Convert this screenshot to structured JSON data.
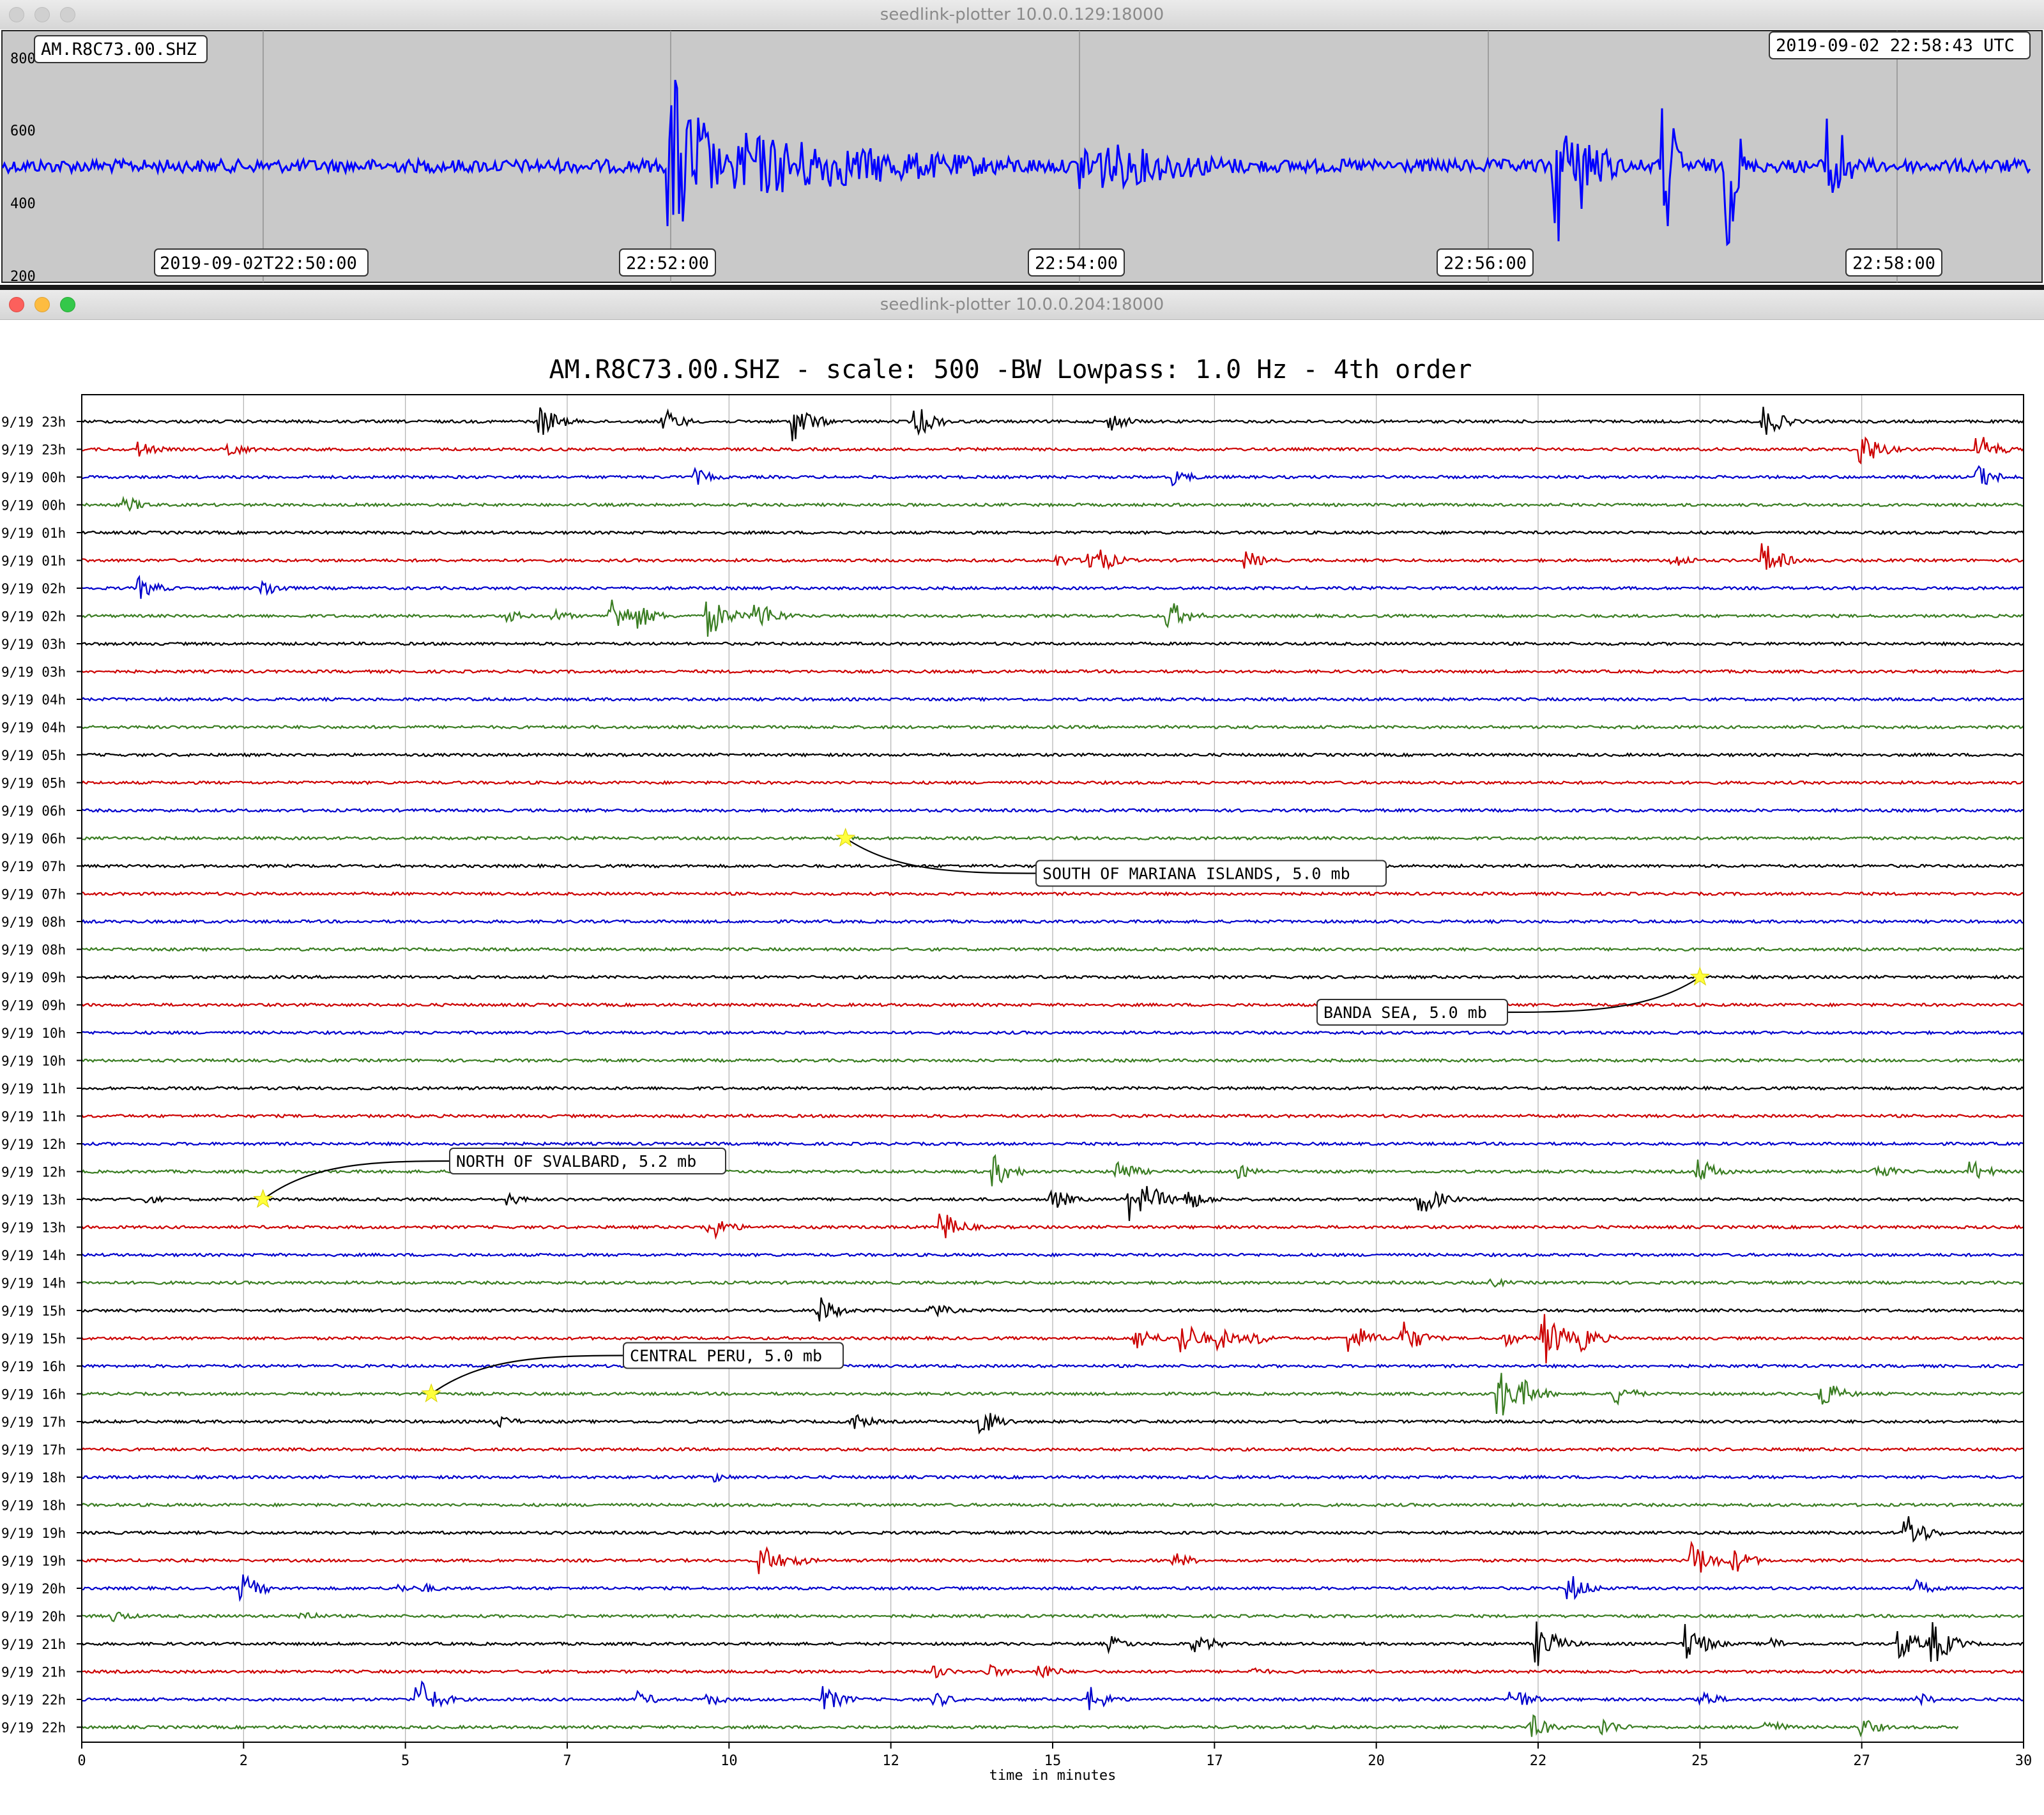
{
  "top_window": {
    "title": "seedlink-plotter 10.0.0.129:18000",
    "station_label": "AM.R8C73.00.SHZ",
    "time_label": "2019-09-02 22:58:43 UTC",
    "y_ticks": [
      "800",
      "600",
      "400",
      "200"
    ],
    "time_ticks": [
      "2019-09-02T22:50:00",
      "22:52:00",
      "22:54:00",
      "22:56:00",
      "22:58:00"
    ],
    "trace_color": "#0000ff",
    "panel_color": "#c9c9c9"
  },
  "bottom_window": {
    "title": "seedlink-plotter 10.0.0.204:18000"
  },
  "chart_data": {
    "type": "line",
    "title": "AM.R8C73.00.SHZ - scale: 500 -BW Lowpass: 1.0 Hz - 4th order",
    "xlabel": "time in minutes",
    "x_ticks": [
      "0",
      "2",
      "5",
      "7",
      "10",
      "12",
      "15",
      "17",
      "20",
      "22",
      "25",
      "27",
      "30"
    ],
    "xlim": [
      0,
      30
    ],
    "grid": true,
    "row_colors": [
      "#000000",
      "#cc0000",
      "#0000cc",
      "#3a7d22"
    ],
    "rows": [
      "9/19 23h",
      "9/19 23h",
      "9/19 00h",
      "9/19 00h",
      "9/19 01h",
      "9/19 01h",
      "9/19 02h",
      "9/19 02h",
      "9/19 03h",
      "9/19 03h",
      "9/19 04h",
      "9/19 04h",
      "9/19 05h",
      "9/19 05h",
      "9/19 06h",
      "9/19 06h",
      "9/19 07h",
      "9/19 07h",
      "9/19 08h",
      "9/19 08h",
      "9/19 09h",
      "9/19 09h",
      "9/19 10h",
      "9/19 10h",
      "9/19 11h",
      "9/19 11h",
      "9/19 12h",
      "9/19 12h",
      "9/19 13h",
      "9/19 13h",
      "9/19 14h",
      "9/19 14h",
      "9/19 15h",
      "9/19 15h",
      "9/19 16h",
      "9/19 16h",
      "9/19 17h",
      "9/19 17h",
      "9/19 18h",
      "9/19 18h",
      "9/19 19h",
      "9/19 19h",
      "9/19 20h",
      "9/19 20h",
      "9/19 21h",
      "9/19 21h",
      "9/19 22h",
      "9/19 22h"
    ],
    "bursts": [
      {
        "row": 0,
        "t": [
          7.1,
          9.0,
          11.0,
          12.9,
          15.9,
          26.0
        ],
        "a": [
          1.0,
          0.8,
          1.3,
          1.0,
          0.6,
          1.0
        ]
      },
      {
        "row": 1,
        "t": [
          0.9,
          2.3,
          27.5,
          29.3
        ],
        "a": [
          0.5,
          0.5,
          1.2,
          1.0
        ]
      },
      {
        "row": 2,
        "t": [
          9.5,
          16.9,
          29.3
        ],
        "a": [
          0.5,
          0.5,
          0.8
        ]
      },
      {
        "row": 3,
        "t": [
          0.7
        ],
        "a": [
          0.5
        ]
      },
      {
        "row": 5,
        "t": [
          15.1,
          15.6,
          18.0,
          24.6,
          26.0
        ],
        "a": [
          0.4,
          1.2,
          0.6,
          0.5,
          1.1
        ]
      },
      {
        "row": 6,
        "t": [
          0.9,
          2.8
        ],
        "a": [
          0.7,
          0.6
        ]
      },
      {
        "row": 7,
        "t": [
          6.6,
          7.3,
          8.2,
          8.6,
          9.7,
          10.4,
          16.8
        ],
        "a": [
          0.4,
          0.4,
          1.2,
          0.8,
          1.3,
          1.2,
          1.0
        ]
      },
      {
        "row": 27,
        "t": [
          14.1,
          16.0,
          17.9,
          25.0,
          27.7,
          29.2
        ],
        "a": [
          1.0,
          0.8,
          0.4,
          0.8,
          0.6,
          0.7
        ]
      },
      {
        "row": 28,
        "t": [
          1.0,
          6.6,
          15.0,
          16.2,
          16.5,
          17.1,
          20.7
        ],
        "a": [
          0.3,
          0.4,
          0.7,
          1.3,
          0.9,
          0.7,
          1.1
        ]
      },
      {
        "row": 29,
        "t": [
          9.7,
          13.3
        ],
        "a": [
          0.9,
          1.0
        ]
      },
      {
        "row": 31,
        "t": [
          21.8
        ],
        "a": [
          0.3
        ]
      },
      {
        "row": 32,
        "t": [
          11.4,
          13.1
        ],
        "a": [
          0.9,
          0.6
        ]
      },
      {
        "row": 33,
        "t": [
          16.3,
          17.0,
          17.6,
          18.1,
          19.6,
          20.4,
          22.0,
          22.6,
          23.2
        ],
        "a": [
          0.8,
          1.2,
          0.7,
          0.5,
          1.1,
          1.2,
          0.5,
          1.8,
          0.8
        ]
      },
      {
        "row": 35,
        "t": [
          21.9,
          22.3,
          23.7,
          26.9
        ],
        "a": [
          1.8,
          0.8,
          0.7,
          0.9
        ]
      },
      {
        "row": 36,
        "t": [
          6.4,
          11.9,
          13.9
        ],
        "a": [
          0.5,
          0.6,
          0.9
        ]
      },
      {
        "row": 38,
        "t": [
          9.8
        ],
        "a": [
          0.3
        ]
      },
      {
        "row": 40,
        "t": [
          28.2
        ],
        "a": [
          1.2
        ]
      },
      {
        "row": 41,
        "t": [
          10.5,
          11.0,
          16.9,
          24.9,
          25.5
        ],
        "a": [
          1.1,
          0.4,
          0.5,
          1.2,
          0.9
        ]
      },
      {
        "row": 42,
        "t": [
          2.5,
          4.9,
          5.3,
          23.0,
          28.3
        ],
        "a": [
          0.9,
          0.3,
          0.3,
          0.9,
          0.6
        ]
      },
      {
        "row": 43,
        "t": [
          0.5,
          3.4
        ],
        "a": [
          0.4,
          0.4
        ]
      },
      {
        "row": 44,
        "t": [
          15.9,
          17.2,
          17.4,
          22.5,
          24.8,
          26.1,
          28.1,
          28.6
        ],
        "a": [
          0.5,
          0.5,
          0.4,
          1.4,
          1.3,
          0.4,
          1.0,
          1.4
        ]
      },
      {
        "row": 45,
        "t": [
          13.2,
          14.0,
          14.8,
          18.1
        ],
        "a": [
          0.4,
          0.5,
          0.6,
          0.3
        ]
      },
      {
        "row": 46,
        "t": [
          5.2,
          8.6,
          9.7,
          11.5,
          13.2,
          15.6,
          22.1,
          25.0,
          28.4
        ],
        "a": [
          1.4,
          0.5,
          0.4,
          0.8,
          0.5,
          0.8,
          0.8,
          0.6,
          0.4
        ]
      },
      {
        "row": 47,
        "t": [
          22.4,
          23.5,
          26.0,
          27.5
        ],
        "a": [
          0.8,
          0.6,
          0.6,
          0.6
        ]
      }
    ],
    "traces_end": {
      "row": 47,
      "t": 29.0
    },
    "annotations": [
      {
        "text": "SOUTH OF MARIANA ISLANDS, 5.0 mb",
        "row": 15,
        "t": 11.8
      },
      {
        "text": "BANDA SEA, 5.0 mb",
        "row": 20,
        "t": 25.0
      },
      {
        "text": "NORTH OF SVALBARD, 5.2 mb",
        "row": 28,
        "t": 2.8
      },
      {
        "text": "CENTRAL PERU, 5.0 mb",
        "row": 35,
        "t": 5.4
      }
    ],
    "star_color": "#ffff3c"
  }
}
